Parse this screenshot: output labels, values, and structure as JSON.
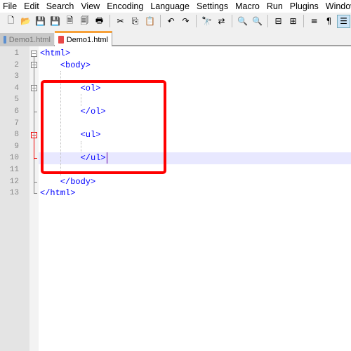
{
  "menu": [
    "File",
    "Edit",
    "Search",
    "View",
    "Encoding",
    "Language",
    "Settings",
    "Macro",
    "Run",
    "Plugins",
    "Window",
    "?"
  ],
  "toolbar": [
    "new-file",
    "open-file",
    "save",
    "save-all",
    "close",
    "close-all",
    "print",
    "cut",
    "copy",
    "paste",
    "undo",
    "redo",
    "find",
    "replace",
    "zoom-in",
    "zoom-out",
    "sync-vertical",
    "sync-horizontal",
    "word-wrap",
    "show-all-characters",
    "indent-guide"
  ],
  "tabs": [
    {
      "label": "Demo1.html",
      "active": false
    },
    {
      "label": "Demo1.html",
      "active": true
    }
  ],
  "editor": {
    "lines": [
      "<html>",
      "    <body>",
      "",
      "        <ol>",
      "",
      "        </ol>",
      "",
      "        <ul>",
      "",
      "        </ul>",
      "",
      "    </body>",
      "</html>"
    ],
    "current_line": 10
  },
  "colors": {
    "tag": "#0000ff",
    "highlight_box": "#ff0000",
    "current_line": "#e8e8ff",
    "active_tab_accent": "#f7a139"
  }
}
